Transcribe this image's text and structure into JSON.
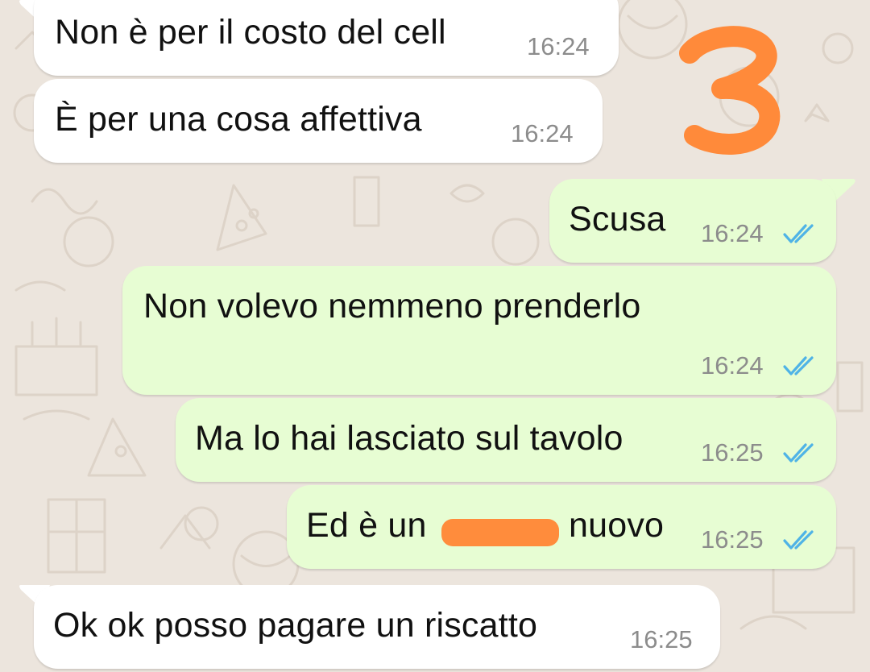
{
  "chat": {
    "messages": [
      {
        "direction": "incoming",
        "text": "Non è per il costo del cell",
        "time": "16:24"
      },
      {
        "direction": "incoming",
        "text": "È per una cosa affettiva",
        "time": "16:24"
      },
      {
        "direction": "outgoing",
        "text": "Scusa",
        "time": "16:24",
        "status": "read-double-check"
      },
      {
        "direction": "outgoing",
        "text": "Non volevo nemmeno prenderlo",
        "time": "16:24",
        "status": "read-double-check"
      },
      {
        "direction": "outgoing",
        "text": "Ma lo hai lasciato sul tavolo",
        "time": "16:25",
        "status": "read-double-check"
      },
      {
        "direction": "outgoing",
        "text_before": "Ed è un ",
        "text_after": "nuovo",
        "time": "16:25",
        "status": "read-double-check",
        "redacted": true
      },
      {
        "direction": "incoming",
        "text": "Ok ok posso pagare un riscatto",
        "time": "16:25"
      }
    ]
  },
  "annotation": {
    "label": "3",
    "color": "#ff8a3a"
  },
  "colors": {
    "wallpaper": "#ece5dd",
    "incoming_bubble": "#ffffff",
    "outgoing_bubble": "#e7fdd3",
    "read_ticks": "#4fb3e6",
    "redaction": "#ff8c3c"
  },
  "icons": [
    "double-check-icon",
    "doodle-wallpaper"
  ]
}
